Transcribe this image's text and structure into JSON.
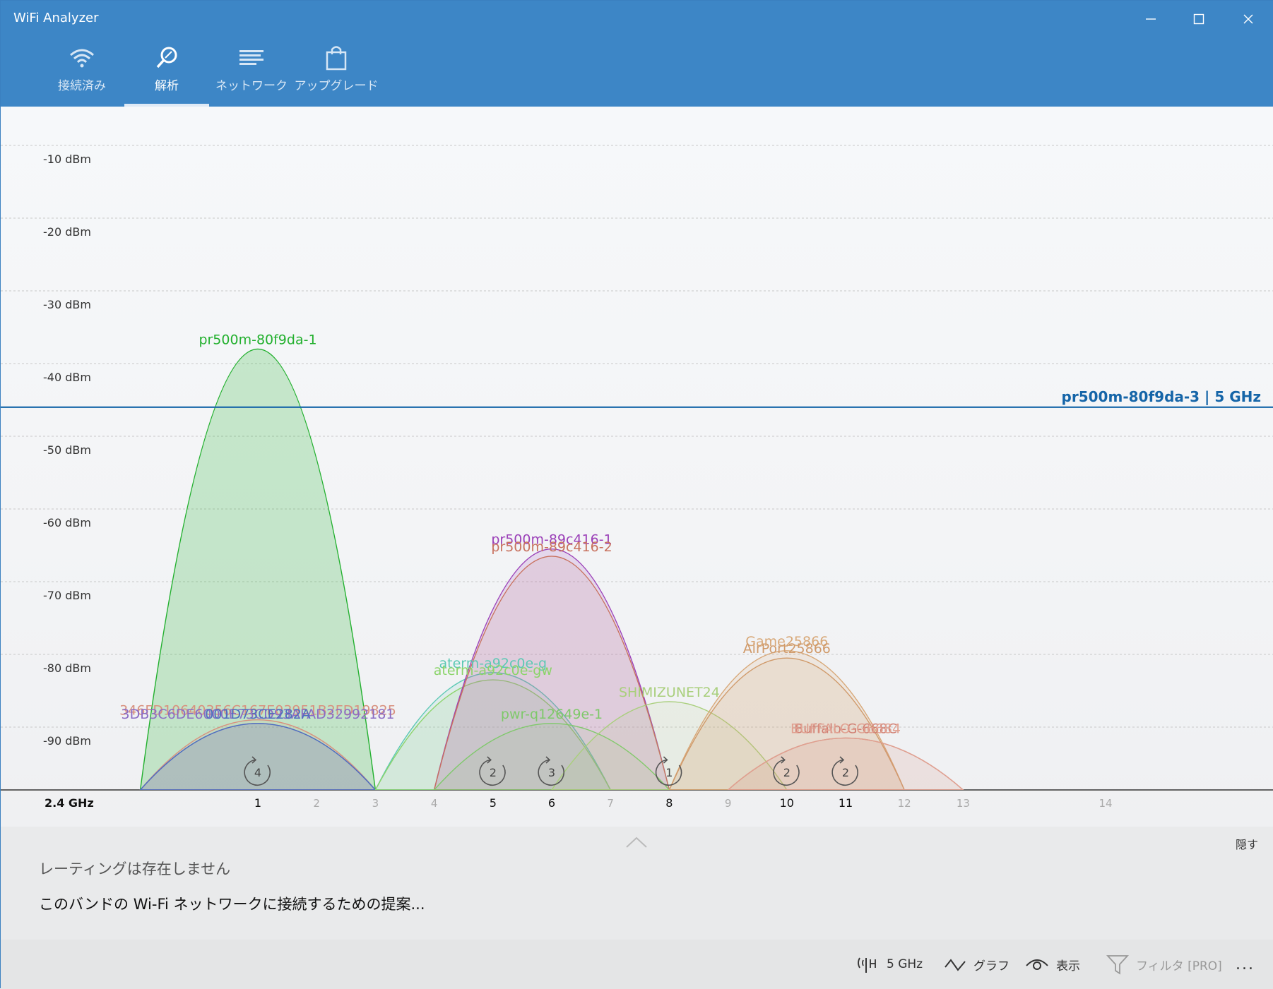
{
  "window": {
    "title": "WiFi Analyzer",
    "controls": {
      "minimize": "—",
      "maximize": "☐",
      "close": "✕"
    }
  },
  "tabs": [
    {
      "label": "接続済み",
      "icon": "wifi-icon"
    },
    {
      "label": "解析",
      "icon": "analyze-icon"
    },
    {
      "label": "ネットワーク",
      "icon": "network-list-icon"
    },
    {
      "label": "アップグレード",
      "icon": "shopping-bag-icon"
    }
  ],
  "colors": {
    "accent": "#3d86c6",
    "connected_line": "#1565a8"
  },
  "chart_data": {
    "type": "area",
    "band": "2.4 GHz",
    "y_unit": "dBm",
    "ylim": [
      -100,
      -5
    ],
    "y_ticks": [
      "-10 dBm",
      "-20 dBm",
      "-30 dBm",
      "-40 dBm",
      "-50 dBm",
      "-60 dBm",
      "-70 dBm",
      "-80 dBm",
      "-90 dBm"
    ],
    "x_ticks": [
      {
        "ch": 1,
        "label": "1",
        "major": true
      },
      {
        "ch": 2,
        "label": "2",
        "major": false
      },
      {
        "ch": 3,
        "label": "3",
        "major": false
      },
      {
        "ch": 4,
        "label": "4",
        "major": false
      },
      {
        "ch": 5,
        "label": "5",
        "major": true
      },
      {
        "ch": 6,
        "label": "6",
        "major": true
      },
      {
        "ch": 7,
        "label": "7",
        "major": false
      },
      {
        "ch": 8,
        "label": "8",
        "major": true
      },
      {
        "ch": 9,
        "label": "9",
        "major": false
      },
      {
        "ch": 10,
        "label": "10",
        "major": true
      },
      {
        "ch": 11,
        "label": "11",
        "major": true
      },
      {
        "ch": 12,
        "label": "12",
        "major": false
      },
      {
        "ch": 13,
        "label": "13",
        "major": false
      },
      {
        "ch": 14,
        "label": "14",
        "major": false
      }
    ],
    "connected_network": {
      "label": "pr500m-80f9da-3 | 5 GHz",
      "dbm": -46
    },
    "series": [
      {
        "name": "pr500m-80f9da-1",
        "channel": 1,
        "dbm": -38,
        "color": "#22b02e",
        "fill": "#22b02e",
        "opacity": 0.22
      },
      {
        "name": "346FD10640356C167E03951B2FD19825",
        "channel": 1,
        "dbm": -89,
        "color": "#d8917f",
        "fill": "#d8917f",
        "opacity": 0.12
      },
      {
        "name": "3DB3C6DE6000E73CD93AFAD32992181",
        "channel": 1,
        "dbm": -89.5,
        "color": "#8b6cc4",
        "fill": "#8b6cc4",
        "opacity": 0.12
      },
      {
        "name": "001D73CE282A",
        "channel": 1,
        "dbm": -89.5,
        "color": "#4d6fbf",
        "fill": "#4d6fbf",
        "opacity": 0.12
      },
      {
        "name": "aterm-a92c0e-g",
        "channel": 5,
        "dbm": -82.5,
        "color": "#5cc9b4",
        "fill": "#5cc9b4",
        "opacity": 0.12
      },
      {
        "name": "aterm-a92c0e-gw",
        "channel": 5,
        "dbm": -83.5,
        "color": "#8bd46a",
        "fill": "#8bd46a",
        "opacity": 0.12
      },
      {
        "name": "pr500m-89c416-1",
        "channel": 6,
        "dbm": -65.5,
        "color": "#9b40b8",
        "fill": "#b070c8",
        "opacity": 0.22
      },
      {
        "name": "pr500m-89c416-2",
        "channel": 6,
        "dbm": -66.5,
        "color": "#c8715e",
        "fill": "#c8715e",
        "opacity": 0.1
      },
      {
        "name": "pwr-q12649e-1",
        "channel": 6,
        "dbm": -89.5,
        "color": "#7ec96a",
        "fill": "#7ec96a",
        "opacity": 0.1
      },
      {
        "name": "SHIMIZUNET24",
        "channel": 8,
        "dbm": -86.5,
        "color": "#a9cf7c",
        "fill": "#a9cf7c",
        "opacity": 0.12
      },
      {
        "name": "Game25866",
        "channel": 10,
        "dbm": -79.5,
        "color": "#d8a878",
        "fill": "#d8a878",
        "opacity": 0.16
      },
      {
        "name": "AirPort25866",
        "channel": 10,
        "dbm": -80.5,
        "color": "#d09a6a",
        "fill": "#d09a6a",
        "opacity": 0.12
      },
      {
        "name": "Buffalo-G-668C",
        "channel": 11,
        "dbm": -91.5,
        "color": "#d07e72",
        "fill": "#d07e72",
        "opacity": 0.1
      },
      {
        "name": "BUFFALO-G6684",
        "channel": 11,
        "dbm": -91.5,
        "color": "#e0a090",
        "fill": "#e0a090",
        "opacity": 0.08
      }
    ],
    "channel_badges": [
      {
        "ch": 1,
        "count": "4"
      },
      {
        "ch": 5,
        "count": "2"
      },
      {
        "ch": 6,
        "count": "3"
      },
      {
        "ch": 8,
        "count": "1"
      },
      {
        "ch": 10,
        "count": "2"
      },
      {
        "ch": 11,
        "count": "2"
      }
    ],
    "grid": true
  },
  "panel": {
    "hide_label": "隠す",
    "rating_text": "レーティングは存在しません",
    "suggest_text": "このバンドの Wi-Fi ネットワークに接続するための提案..."
  },
  "commands": [
    {
      "label": "5 GHz",
      "icon": "antenna-icon",
      "disabled": false
    },
    {
      "label": "グラフ",
      "icon": "graph-icon",
      "disabled": false
    },
    {
      "label": "表示",
      "icon": "eye-icon",
      "disabled": false
    },
    {
      "label": "フィルタ [PRO]",
      "icon": "filter-icon",
      "disabled": true
    },
    {
      "label": "...",
      "icon": "more-icon",
      "disabled": false
    }
  ]
}
